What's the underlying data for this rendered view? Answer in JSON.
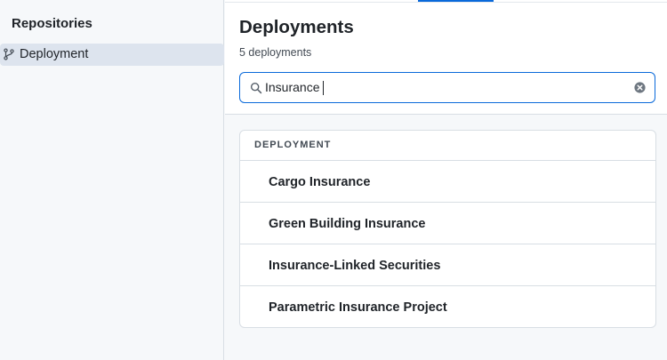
{
  "sidebar": {
    "title": "Repositories",
    "items": [
      {
        "label": "Deployment",
        "icon": "git-branch-icon"
      }
    ]
  },
  "main": {
    "title": "Deployments",
    "count_text": "5 deployments",
    "search": {
      "value": "Insurance",
      "placeholder": ""
    },
    "list": {
      "header": "DEPLOYMENT",
      "items": [
        "Cargo Insurance",
        "Green Building Insurance",
        "Insurance-Linked Securities",
        "Parametric Insurance Project"
      ]
    }
  },
  "colors": {
    "accent": "#0969da",
    "sidebar_selected": "#dde4ee",
    "background": "#f6f8fa"
  }
}
